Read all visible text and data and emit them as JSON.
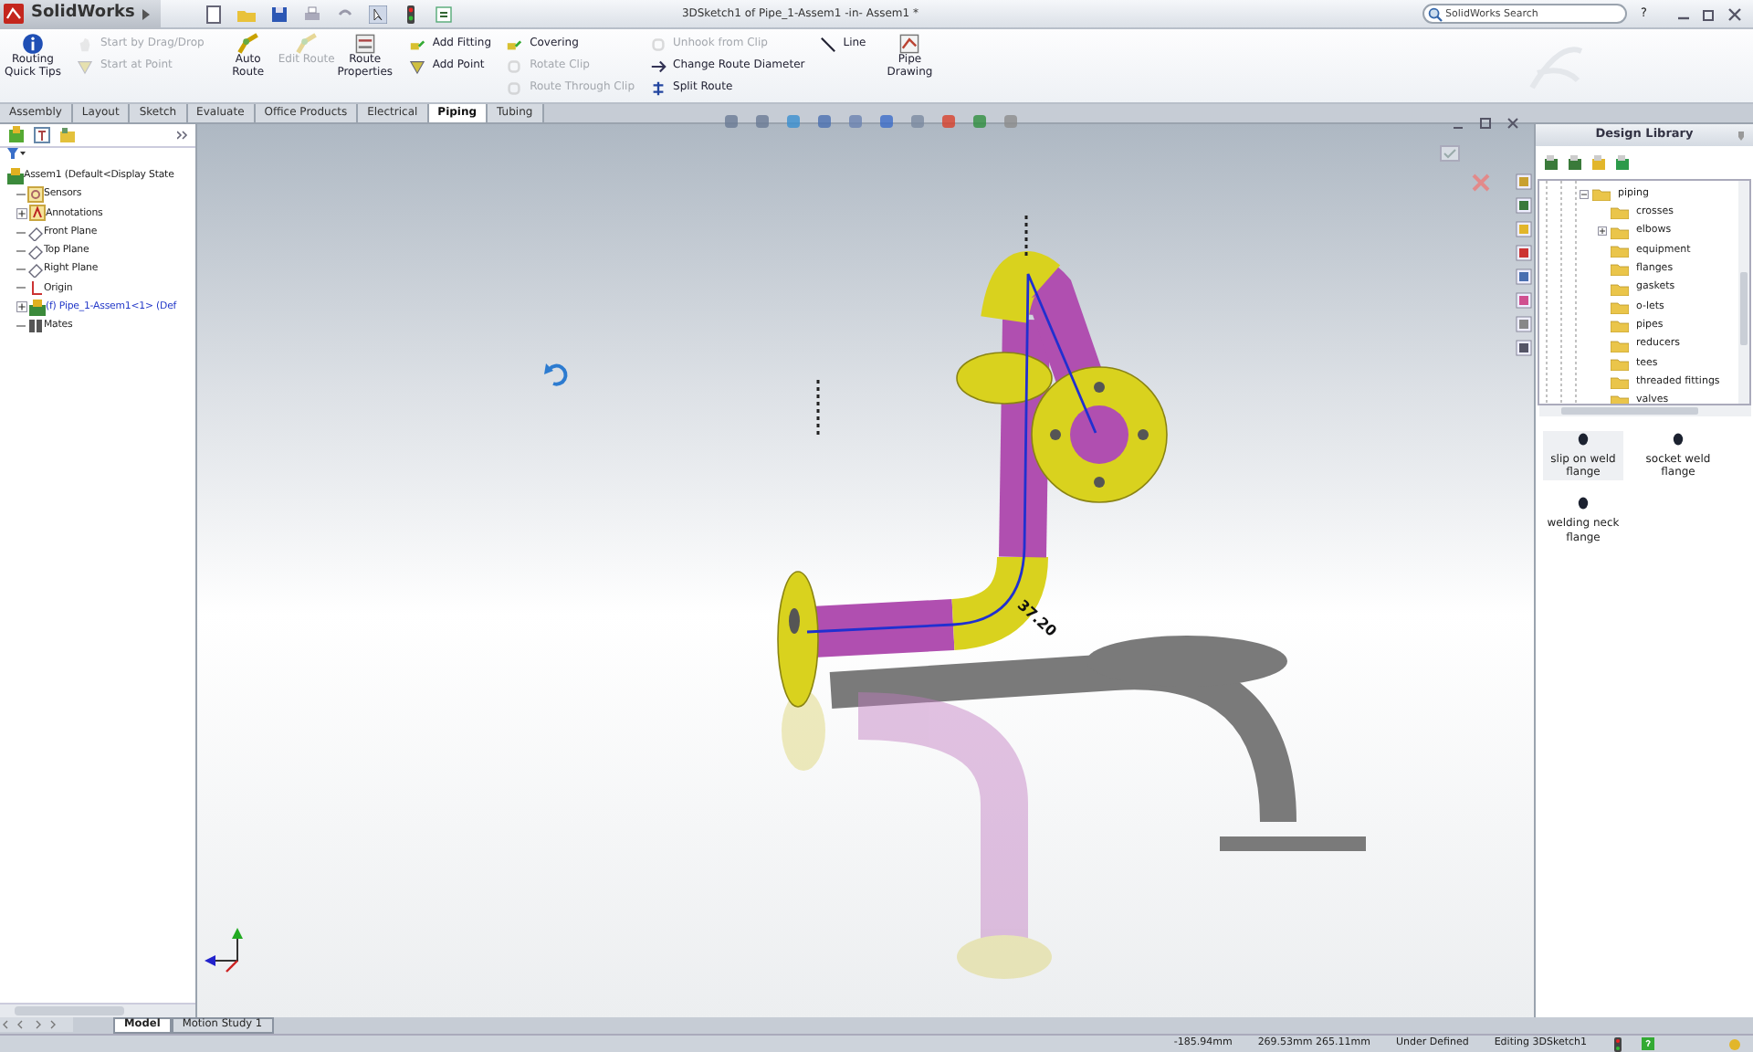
{
  "app": {
    "name": "SolidWorks"
  },
  "window": {
    "title": "3DSketch1 of Pipe_1-Assem1 -in- Assem1 *"
  },
  "search": {
    "placeholder": "SolidWorks Search"
  },
  "help": "?",
  "ribbon": {
    "groups": [
      {
        "kind": "large",
        "items": [
          {
            "label": "Routing Quick Tips",
            "disabled": false
          }
        ]
      },
      {
        "kind": "stack",
        "items": [
          {
            "label": "Start by Drag/Drop",
            "disabled": true
          },
          {
            "label": "Start at Point",
            "disabled": true
          }
        ]
      },
      {
        "kind": "large",
        "items": [
          {
            "label": "Auto Route",
            "disabled": false
          },
          {
            "label": "Edit Route",
            "disabled": true
          },
          {
            "label": "Route Properties",
            "disabled": false
          }
        ]
      },
      {
        "kind": "stack",
        "items": [
          {
            "label": "Add Fitting",
            "disabled": false
          },
          {
            "label": "Add Point",
            "disabled": false
          }
        ]
      },
      {
        "kind": "stack",
        "items": [
          {
            "label": "Covering",
            "disabled": false
          },
          {
            "label": "Rotate Clip",
            "disabled": true
          },
          {
            "label": "Route Through Clip",
            "disabled": true
          }
        ]
      },
      {
        "kind": "stack",
        "items": [
          {
            "label": "Unhook from Clip",
            "disabled": true
          },
          {
            "label": "Change Route Diameter",
            "disabled": false
          },
          {
            "label": "Split Route",
            "disabled": false
          }
        ]
      },
      {
        "kind": "stack",
        "items": [
          {
            "label": "Line",
            "disabled": false
          }
        ]
      },
      {
        "kind": "large",
        "items": [
          {
            "label": "Pipe Drawing",
            "disabled": false
          }
        ]
      }
    ]
  },
  "tabs": [
    {
      "label": "Assembly",
      "selected": false
    },
    {
      "label": "Layout",
      "selected": false
    },
    {
      "label": "Sketch",
      "selected": false
    },
    {
      "label": "Evaluate",
      "selected": false
    },
    {
      "label": "Office Products",
      "selected": false
    },
    {
      "label": "Electrical",
      "selected": false
    },
    {
      "label": "Piping",
      "selected": true
    },
    {
      "label": "Tubing",
      "selected": false
    }
  ],
  "feature_tree": {
    "items": [
      {
        "kind": "assembly",
        "label": "Assem1  (Default<Display State",
        "editing": false,
        "children": [
          {
            "kind": "sensor",
            "label": "Sensors",
            "editing": false
          },
          {
            "kind": "annotation",
            "label": "Annotations",
            "editing": false,
            "expanded": false
          },
          {
            "kind": "plane",
            "label": "Front Plane",
            "editing": false
          },
          {
            "kind": "plane",
            "label": "Top Plane",
            "editing": false
          },
          {
            "kind": "plane",
            "label": "Right Plane",
            "editing": false
          },
          {
            "kind": "origin",
            "label": "Origin",
            "editing": false
          },
          {
            "kind": "assembly",
            "label": "(f) Pipe_1-Assem1<1> (Def",
            "editing": true,
            "expanded": false
          },
          {
            "kind": "mates",
            "label": "Mates",
            "editing": false
          }
        ]
      }
    ]
  },
  "viewport": {
    "dimension": "37.20"
  },
  "design_library": {
    "title": "Design Library",
    "tree": [
      {
        "kind": "branch",
        "label": "piping",
        "expanded": true,
        "children": [
          {
            "kind": "leaf",
            "label": "crosses"
          },
          {
            "kind": "branch",
            "label": "elbows",
            "expanded": false
          },
          {
            "kind": "leaf",
            "label": "equipment"
          },
          {
            "kind": "leaf",
            "label": "flanges"
          },
          {
            "kind": "leaf",
            "label": "gaskets"
          },
          {
            "kind": "leaf",
            "label": "o-lets"
          },
          {
            "kind": "leaf",
            "label": "pipes"
          },
          {
            "kind": "leaf",
            "label": "reducers"
          },
          {
            "kind": "leaf",
            "label": "tees"
          },
          {
            "kind": "leaf",
            "label": "threaded fittings"
          },
          {
            "kind": "leaf",
            "label": "valves"
          }
        ]
      }
    ],
    "items": [
      {
        "label": "slip on weld flange",
        "selected": true
      },
      {
        "label": "socket weld flange",
        "selected": false
      },
      {
        "label": "welding neck flange",
        "selected": false
      }
    ]
  },
  "bottom_tabs": [
    {
      "label": "Model",
      "selected": true
    },
    {
      "label": "Motion Study 1",
      "selected": false
    }
  ],
  "status_bar": [
    "-185.94mm",
    "269.53mm 265.11mm",
    "Under Defined",
    "Editing 3DSketch1"
  ]
}
